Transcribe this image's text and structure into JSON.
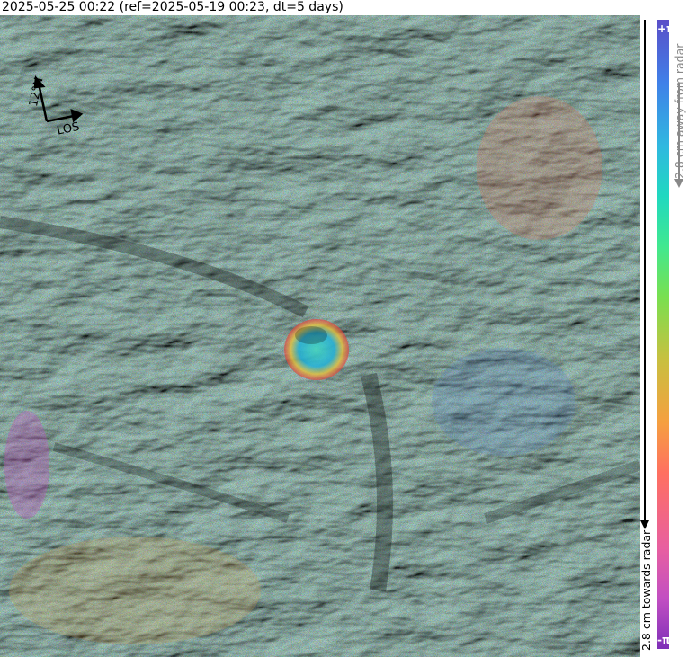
{
  "header": {
    "title": "2025-05-25 00:22 (ref=2025-05-19 00:23, dt=5 days)"
  },
  "compass": {
    "north_label": "12°N",
    "los_label": "LOS"
  },
  "colorbar": {
    "top_label": "+π",
    "bottom_label": "-π",
    "away_label": "2.8 cm away from radar",
    "towards_label": "2.8 cm towards radar"
  },
  "colors": {
    "background": "#ffffff",
    "text": "#000000",
    "away_text": "#888888"
  }
}
